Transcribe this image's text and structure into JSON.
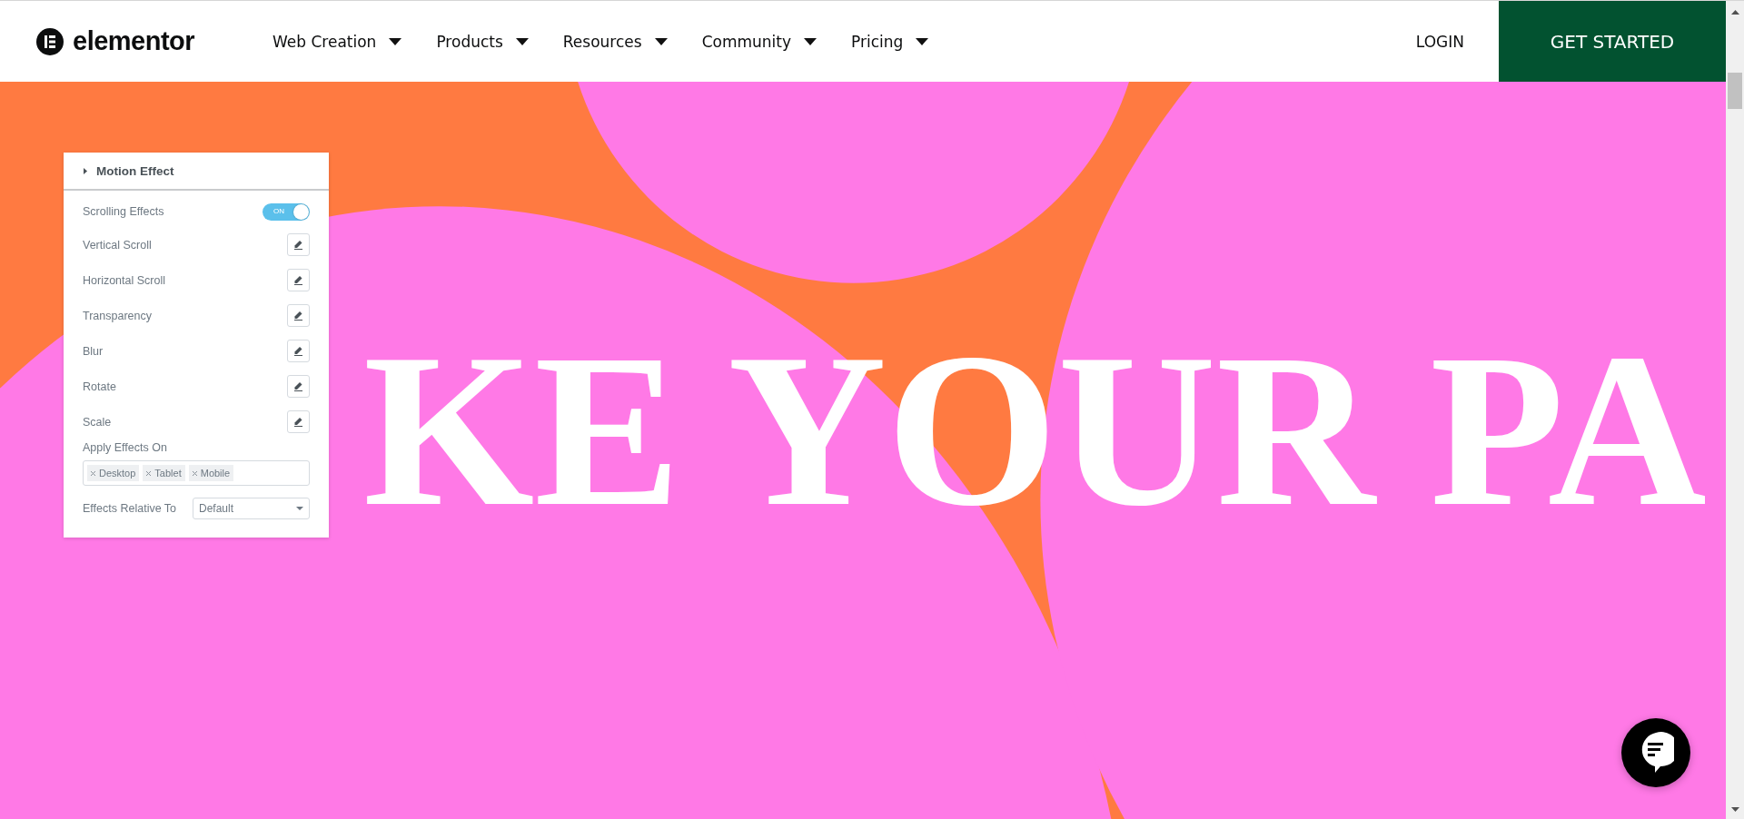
{
  "nav": {
    "logo": "elementor",
    "menu": [
      {
        "label": "Web Creation"
      },
      {
        "label": "Products"
      },
      {
        "label": "Resources"
      },
      {
        "label": "Community"
      },
      {
        "label": "Pricing"
      }
    ],
    "login": "LOGIN",
    "cta": "GET STARTED"
  },
  "hero": {
    "headline": "KE YOUR PA",
    "panel": {
      "title": "Motion Effect",
      "rows": [
        {
          "kind": "toggle",
          "label": "Scrolling Effects",
          "on": true,
          "toggle_text": "ON"
        },
        {
          "kind": "edit",
          "label": "Vertical Scroll"
        },
        {
          "kind": "edit",
          "label": "Horizontal Scroll"
        },
        {
          "kind": "edit",
          "label": "Transparency"
        },
        {
          "kind": "edit",
          "label": "Blur"
        },
        {
          "kind": "edit",
          "label": "Rotate"
        },
        {
          "kind": "edit",
          "label": "Scale"
        }
      ],
      "apply_label": "Apply Effects On",
      "tags": [
        "Desktop",
        "Tablet",
        "Mobile"
      ],
      "relative_label": "Effects Relative To",
      "relative_value": "Default"
    }
  }
}
